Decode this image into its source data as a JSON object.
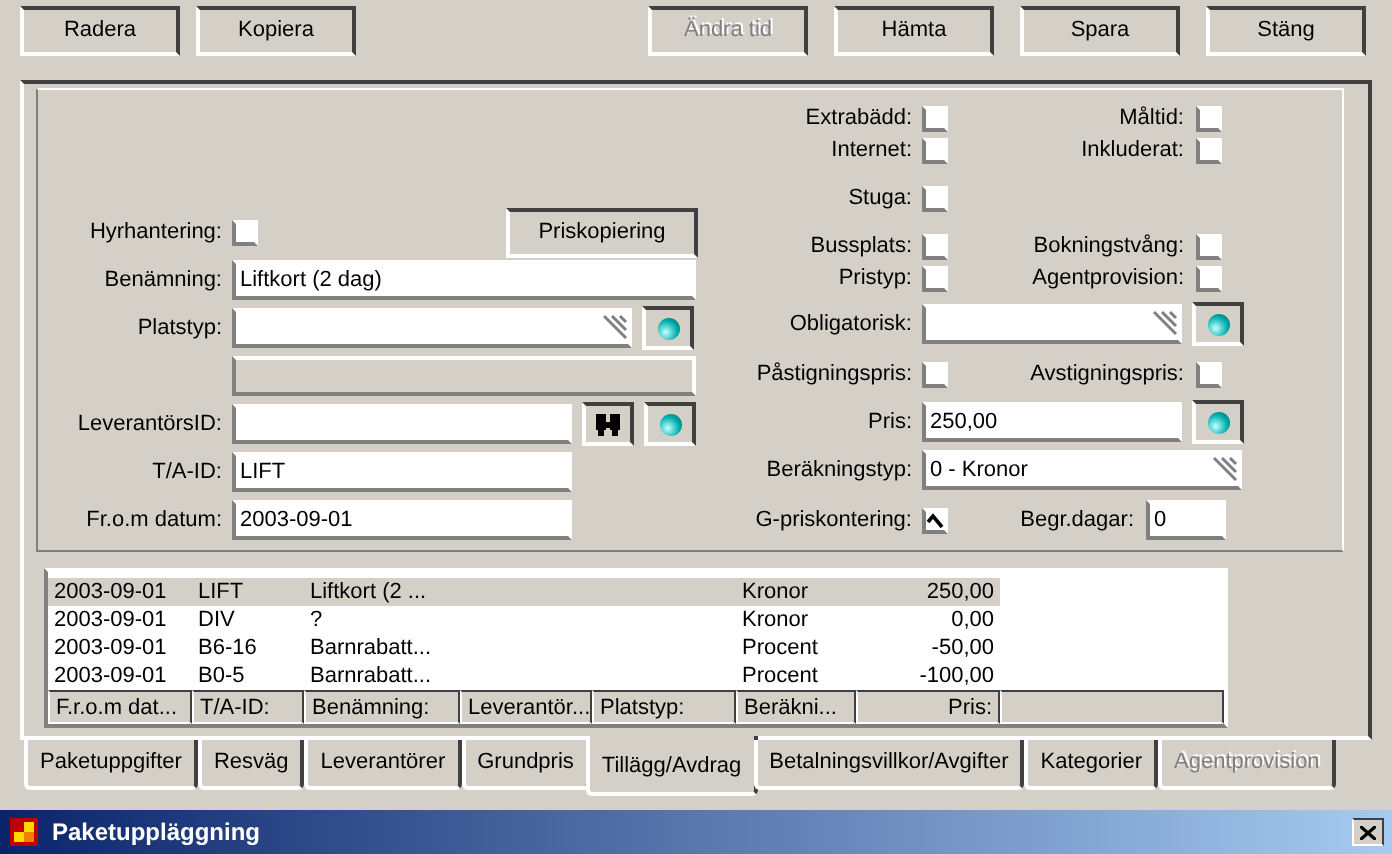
{
  "buttons_left": [
    {
      "label": "Radera",
      "disabled": false
    },
    {
      "label": "Kopiera",
      "disabled": false
    }
  ],
  "buttons_right": [
    {
      "label": "Ändra tid",
      "disabled": true
    },
    {
      "label": "Hämta",
      "disabled": false
    },
    {
      "label": "Spara",
      "disabled": false
    },
    {
      "label": "Stäng",
      "disabled": false
    }
  ],
  "form": {
    "copy_button": "Priskopiering",
    "left": [
      {
        "kind": "checkbox",
        "label": "Hyrhantering:",
        "checked": false
      },
      {
        "kind": "wide",
        "label": "Benämning:",
        "value": "Liftkort (2 dag)"
      },
      {
        "kind": "dropdown",
        "label": "Platstyp:"
      },
      {
        "kind": "readonly"
      },
      {
        "kind": "lookup",
        "label": "LeverantörsID:"
      },
      {
        "kind": "text",
        "label": "T/A-ID:",
        "value": "LIFT"
      },
      {
        "kind": "text",
        "label": "Fr.o.m datum:",
        "value": "2003-09-01"
      }
    ],
    "right": [
      [
        {
          "kind": "checkbox",
          "label": "Extrabädd:",
          "checked": false
        },
        {
          "kind": "checkbox",
          "label": "Måltid:",
          "checked": false
        }
      ],
      [
        {
          "kind": "checkbox",
          "label": "Internet:",
          "checked": false
        },
        {
          "kind": "checkbox",
          "label": "Inkluderat:",
          "checked": false
        }
      ],
      [
        {
          "kind": "checkbox",
          "label": "Stuga:",
          "checked": false
        }
      ],
      [
        {
          "kind": "checkbox",
          "label": "Bussplats:",
          "checked": false
        },
        {
          "kind": "checkbox",
          "label": "Bokningstvång:",
          "checked": false
        }
      ],
      [
        {
          "kind": "checkbox",
          "label": "Pristyp:",
          "checked": false
        },
        {
          "kind": "checkbox",
          "label": "Agentprovision:",
          "checked": false
        }
      ],
      [
        {
          "kind": "picker",
          "label": "Obligatorisk:"
        }
      ],
      [
        {
          "kind": "checkbox",
          "label": "Påstigningspris:",
          "checked": false
        },
        {
          "kind": "checkbox",
          "label": "Avstigningspris:",
          "checked": false
        }
      ],
      [
        {
          "kind": "text",
          "label": "Pris:",
          "value": "250,00"
        }
      ],
      [
        {
          "kind": "dropdown",
          "label": "Beräkningstyp:",
          "value": "0 - Kronor"
        }
      ],
      [
        {
          "kind": "checkbox",
          "label": "G-priskontering:",
          "checked": true
        },
        {
          "kind": "number",
          "label": "Begr.dagar:",
          "value": "0"
        }
      ]
    ]
  },
  "table": {
    "rows": [
      {
        "cells": [
          "2003-09-01",
          "LIFT",
          "Liftkort (2 ...",
          "",
          "",
          "Kronor",
          "250,00"
        ],
        "selected": true
      },
      {
        "cells": [
          "2003-09-01",
          "DIV",
          "?",
          "",
          "",
          "Kronor",
          "0,00"
        ],
        "selected": false
      },
      {
        "cells": [
          "2003-09-01",
          "B6-16",
          "Barnrabatt...",
          "",
          "",
          "Procent",
          "-50,00"
        ],
        "selected": false
      },
      {
        "cells": [
          "2003-09-01",
          "B0-5",
          "Barnrabatt...",
          "",
          "",
          "Procent",
          "-100,00"
        ],
        "selected": false
      }
    ],
    "bottom_header": [
      "F.r.o.m dat...",
      "T/A-ID:",
      "Benämning:",
      "Leverantör...",
      "Platstyp:",
      "Beräkni...",
      "Pris:"
    ]
  },
  "tabs": [
    {
      "label": "Paketuppgifter",
      "selected": false,
      "disabled": false
    },
    {
      "label": "Resväg",
      "selected": false,
      "disabled": false
    },
    {
      "label": "Leverantörer",
      "selected": false,
      "disabled": false
    },
    {
      "label": "Grundpris",
      "selected": false,
      "disabled": false
    },
    {
      "label": "Tillägg/Avdrag",
      "selected": true,
      "disabled": false
    },
    {
      "label": "Betalningsvillkor/Avgifter",
      "selected": false,
      "disabled": false
    },
    {
      "label": "Kategorier",
      "selected": false,
      "disabled": false
    },
    {
      "label": "Agentprovision",
      "selected": false,
      "disabled": true
    }
  ],
  "window": {
    "title": "Paketuppläggning"
  }
}
